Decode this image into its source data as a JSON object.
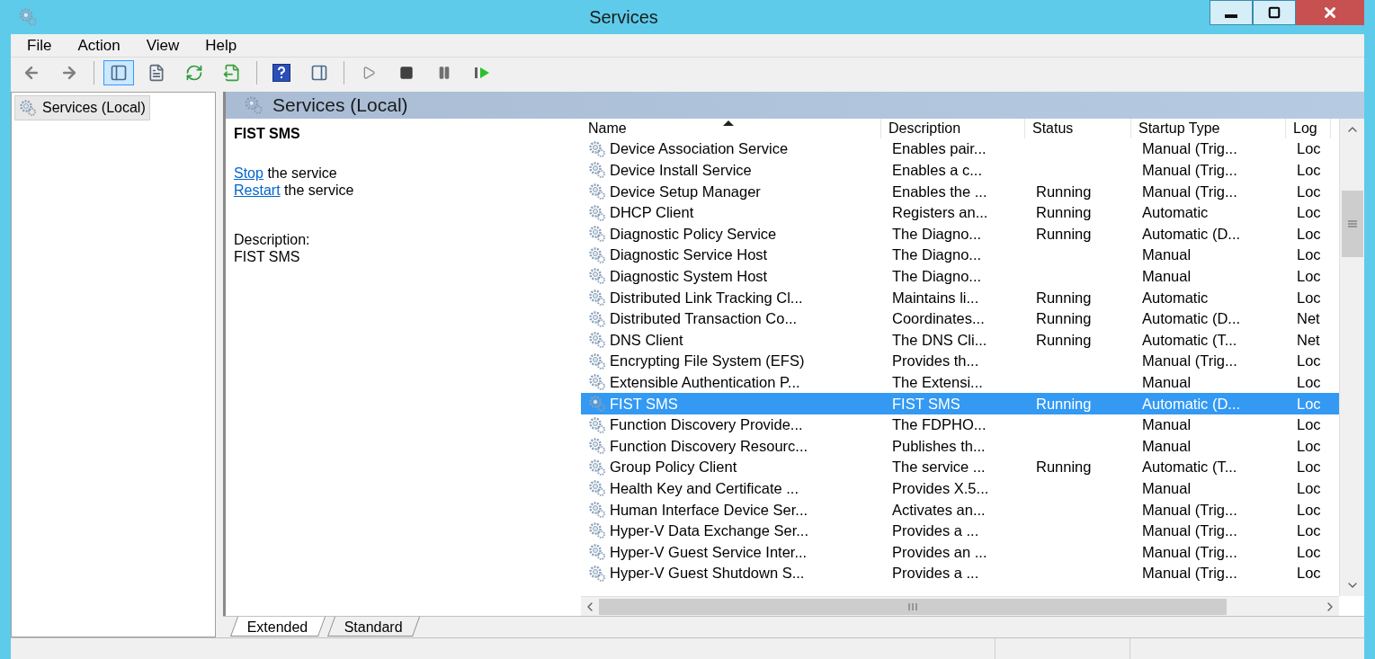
{
  "window": {
    "title": "Services"
  },
  "menu": [
    "File",
    "Action",
    "View",
    "Help"
  ],
  "toolbar": [
    {
      "kind": "back",
      "pressed": false
    },
    {
      "kind": "forward",
      "pressed": false
    },
    {
      "kind": "sep"
    },
    {
      "kind": "tree",
      "pressed": true
    },
    {
      "kind": "properties",
      "pressed": false
    },
    {
      "kind": "refresh",
      "pressed": false
    },
    {
      "kind": "export",
      "pressed": false
    },
    {
      "kind": "sep"
    },
    {
      "kind": "help",
      "pressed": false
    },
    {
      "kind": "actionpane",
      "pressed": false
    },
    {
      "kind": "sep"
    },
    {
      "kind": "play",
      "pressed": false
    },
    {
      "kind": "stop",
      "pressed": false
    },
    {
      "kind": "pause",
      "pressed": false
    },
    {
      "kind": "resume",
      "pressed": false
    }
  ],
  "tree": [
    {
      "label": "Services (Local)",
      "selected": true
    }
  ],
  "pane_title": "Services (Local)",
  "details": {
    "title": "FIST SMS",
    "actions": [
      {
        "link": "Stop",
        "text": "the service"
      },
      {
        "link": "Restart",
        "text": "the service"
      }
    ],
    "description_label": "Description:",
    "description": "FIST SMS"
  },
  "table": {
    "columns": [
      "Name",
      "Description",
      "Status",
      "Startup Type",
      "Log"
    ],
    "rows": [
      {
        "name": "Device Association Service",
        "description": "Enables pair...",
        "status": "",
        "startup": "Manual (Trig...",
        "log": "Loc",
        "selected": false
      },
      {
        "name": "Device Install Service",
        "description": "Enables a c...",
        "status": "",
        "startup": "Manual (Trig...",
        "log": "Loc",
        "selected": false
      },
      {
        "name": "Device Setup Manager",
        "description": "Enables the ...",
        "status": "Running",
        "startup": "Manual (Trig...",
        "log": "Loc",
        "selected": false
      },
      {
        "name": "DHCP Client",
        "description": "Registers an...",
        "status": "Running",
        "startup": "Automatic",
        "log": "Loc",
        "selected": false
      },
      {
        "name": "Diagnostic Policy Service",
        "description": "The Diagno...",
        "status": "Running",
        "startup": "Automatic (D...",
        "log": "Loc",
        "selected": false
      },
      {
        "name": "Diagnostic Service Host",
        "description": "The Diagno...",
        "status": "",
        "startup": "Manual",
        "log": "Loc",
        "selected": false
      },
      {
        "name": "Diagnostic System Host",
        "description": "The Diagno...",
        "status": "",
        "startup": "Manual",
        "log": "Loc",
        "selected": false
      },
      {
        "name": "Distributed Link Tracking Cl...",
        "description": "Maintains li...",
        "status": "Running",
        "startup": "Automatic",
        "log": "Loc",
        "selected": false
      },
      {
        "name": "Distributed Transaction Co...",
        "description": "Coordinates...",
        "status": "Running",
        "startup": "Automatic (D...",
        "log": "Net",
        "selected": false
      },
      {
        "name": "DNS Client",
        "description": "The DNS Cli...",
        "status": "Running",
        "startup": "Automatic (T...",
        "log": "Net",
        "selected": false
      },
      {
        "name": "Encrypting File System (EFS)",
        "description": "Provides th...",
        "status": "",
        "startup": "Manual (Trig...",
        "log": "Loc",
        "selected": false
      },
      {
        "name": "Extensible Authentication P...",
        "description": "The Extensi...",
        "status": "",
        "startup": "Manual",
        "log": "Loc",
        "selected": false
      },
      {
        "name": "FIST SMS",
        "description": "FIST SMS",
        "status": "Running",
        "startup": "Automatic (D...",
        "log": "Loc",
        "selected": true
      },
      {
        "name": "Function Discovery Provide...",
        "description": "The FDPHO...",
        "status": "",
        "startup": "Manual",
        "log": "Loc",
        "selected": false
      },
      {
        "name": "Function Discovery Resourc...",
        "description": "Publishes th...",
        "status": "",
        "startup": "Manual",
        "log": "Loc",
        "selected": false
      },
      {
        "name": "Group Policy Client",
        "description": "The service ...",
        "status": "Running",
        "startup": "Automatic (T...",
        "log": "Loc",
        "selected": false
      },
      {
        "name": "Health Key and Certificate ...",
        "description": "Provides X.5...",
        "status": "",
        "startup": "Manual",
        "log": "Loc",
        "selected": false
      },
      {
        "name": "Human Interface Device Ser...",
        "description": "Activates an...",
        "status": "",
        "startup": "Manual (Trig...",
        "log": "Loc",
        "selected": false
      },
      {
        "name": "Hyper-V Data Exchange Ser...",
        "description": "Provides a ...",
        "status": "",
        "startup": "Manual (Trig...",
        "log": "Loc",
        "selected": false
      },
      {
        "name": "Hyper-V Guest Service Inter...",
        "description": "Provides an ...",
        "status": "",
        "startup": "Manual (Trig...",
        "log": "Loc",
        "selected": false
      },
      {
        "name": "Hyper-V Guest Shutdown S...",
        "description": "Provides a ...",
        "status": "",
        "startup": "Manual (Trig...",
        "log": "Loc",
        "selected": false
      }
    ]
  },
  "view_tabs": [
    {
      "label": "Extended",
      "selected": true
    },
    {
      "label": "Standard",
      "selected": false
    }
  ]
}
